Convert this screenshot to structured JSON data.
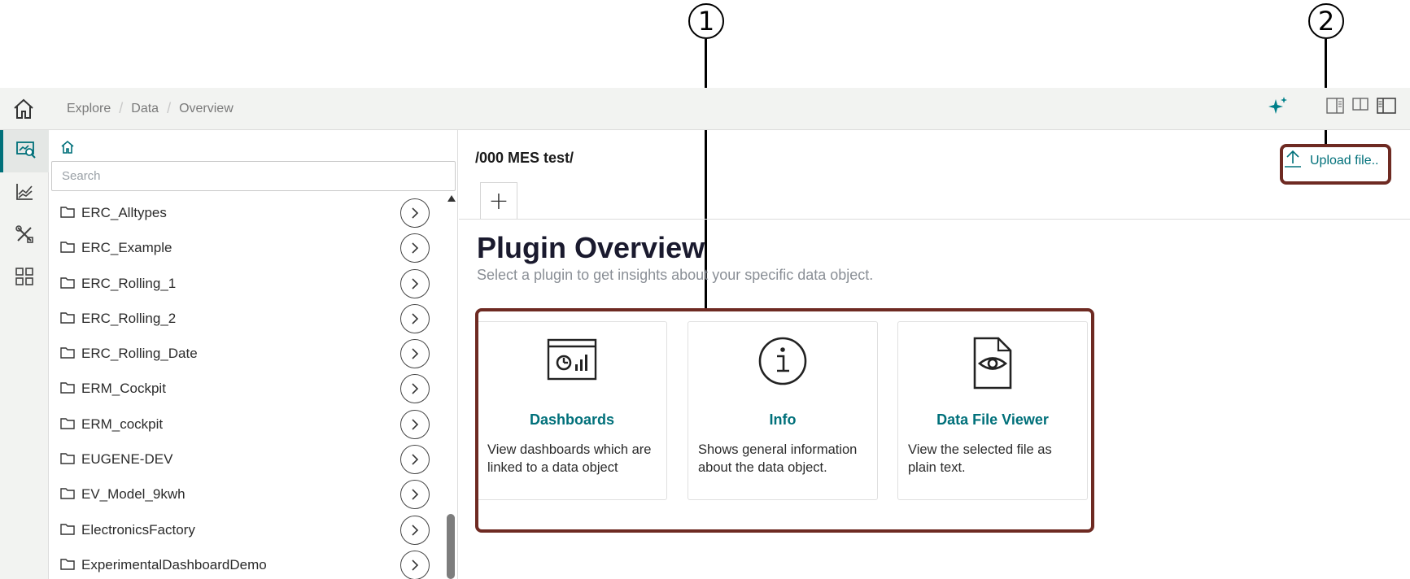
{
  "callouts": {
    "one": "1",
    "two": "2"
  },
  "breadcrumb": {
    "items": [
      "Explore",
      "Data",
      "Overview"
    ]
  },
  "sidebar_rail": {
    "items": [
      {
        "name": "home-icon"
      },
      {
        "name": "explore-icon",
        "active": true
      },
      {
        "name": "chart-icon"
      },
      {
        "name": "tools-icon"
      },
      {
        "name": "apps-grid-icon"
      }
    ]
  },
  "search": {
    "placeholder": "Search",
    "value": ""
  },
  "folders": [
    "ERC_Alltypes",
    "ERC_Example",
    "ERC_Rolling_1",
    "ERC_Rolling_2",
    "ERC_Rolling_Date",
    "ERM_Cockpit",
    "ERM_cockpit",
    "EUGENE-DEV",
    "EV_Model_9kwh",
    "ElectronicsFactory",
    "ExperimentalDashboardDemo"
  ],
  "main": {
    "path": "/000 MES test/",
    "add_tab": "+",
    "upload_label": "Upload file..",
    "title": "Plugin Overview",
    "subtitle": "Select a plugin to get insights about your specific data object."
  },
  "plugins": [
    {
      "title": "Dashboards",
      "description": "View dashboards which are linked to a data object",
      "icon": "dashboard-icon"
    },
    {
      "title": "Info",
      "description": "Shows general information about the data object.",
      "icon": "info-icon"
    },
    {
      "title": "Data File Viewer",
      "description": "View the selected file as plain text.",
      "icon": "file-eye-icon"
    }
  ],
  "colors": {
    "accent": "#00707a",
    "highlight": "#6e2a22",
    "rail_bg": "#f2f3f1"
  }
}
